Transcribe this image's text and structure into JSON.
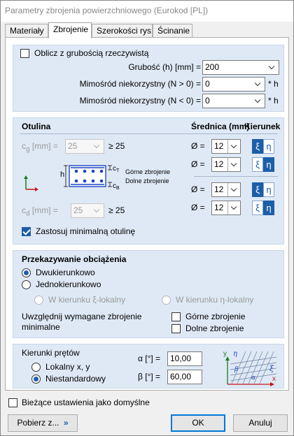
{
  "window": {
    "title": "Parametry zbrojenia powierzchniowego (Eurokod [PL])"
  },
  "tabs": [
    {
      "label": "Materiały"
    },
    {
      "label": "Zbrojenie"
    },
    {
      "label": "Szerokości rys"
    },
    {
      "label": "Ścinanie"
    }
  ],
  "thickness": {
    "checkbox_label": "Oblicz z grubością rzeczywistą",
    "thickness_label": "Grubość (h) [mm] =",
    "thickness_value": "200",
    "ecc_pos_label": "Mimośród niekorzystny (N > 0) =",
    "ecc_pos_value": "0",
    "ecc_neg_label": "Mimośród niekorzystny (N < 0) =",
    "ecc_neg_value": "0",
    "unit_suffix": "* h"
  },
  "cover": {
    "header_otulina": "Otulina",
    "header_diameter": "Średnica (mm)",
    "header_direction": "Kierunek",
    "cg_label_sym": "c",
    "cg_label_sub": "g",
    "cg_label_rest": " [mm] =",
    "cg_value": "25",
    "cg_min": "≥ 25",
    "cd_label_sym": "c",
    "cd_label_sub": "d",
    "cd_label_rest": " [mm] =",
    "cd_value": "25",
    "cd_min": "≥ 25",
    "diameter_prefix": "Ø =",
    "bars": [
      {
        "diameter": "12"
      },
      {
        "diameter": "12"
      },
      {
        "diameter": "12"
      },
      {
        "diameter": "12"
      }
    ],
    "xi": "ξ",
    "eta": "η",
    "diagram_top_label": "Górne zbrojenie",
    "diagram_bottom_label": "Dolne zbrojenie",
    "diagram_h": "h",
    "diagram_ct": "c",
    "diagram_ct_sub": "T",
    "diagram_cb": "c",
    "diagram_cb_sub": "B",
    "min_cover_label": "Zastosuj minimalną otulinę"
  },
  "load": {
    "title": "Przekazywanie obciążenia",
    "two_way": "Dwukierunkowo",
    "one_way": "Jednokierunkowo",
    "dir_xi": "W kierunku ξ-lokalny",
    "dir_eta": "W kierunku η-lokalny",
    "min_reinf_label_1": "Uwzględnij wymagane zbrojenie",
    "min_reinf_label_2": "minimalne",
    "top_reinf": "Górne zbrojenie",
    "bottom_reinf": "Dolne zbrojenie"
  },
  "bars_dir": {
    "title": "Kierunki prętów",
    "local_xy": "Lokalny x, y",
    "custom": "Niestandardowy",
    "alpha_label": "α [°] =",
    "alpha_value": "10,00",
    "beta_label": "β [°] =",
    "beta_value": "60,00",
    "diag_y": "y",
    "diag_x": "x",
    "diag_eta": "η",
    "diag_xi": "ξ",
    "diag_alpha": "α",
    "diag_beta": "β"
  },
  "footer": {
    "default_checkbox": "Bieżące ustawienia jako domyślne",
    "load_from": "Pobierz z...",
    "load_from_icon": "»",
    "ok": "OK",
    "cancel": "Anuluj"
  },
  "colors": {
    "accent": "#1d5ea8",
    "section_bg": "#dfe9f6",
    "diagram_blue": "#1d44c4"
  }
}
